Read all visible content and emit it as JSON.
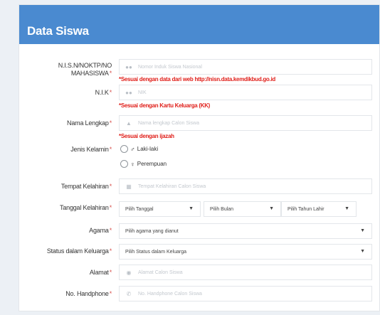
{
  "header": {
    "title": "Data Siswa"
  },
  "fields": {
    "nisn": {
      "label_line1": "N.I.S.N/NOKTP/NO",
      "label_line2": "MAHASISWA",
      "placeholder": "Nomor Induk Siswa Nasional",
      "icon": "user-group-icon"
    },
    "nisn_note": "*Sesuai dengan data dari web http://nisn.data.kemdikbud.go.id",
    "nik": {
      "label": "N.I.K",
      "placeholder": "NIK",
      "icon": "user-group-icon"
    },
    "nik_note": "*Sesuai dengan Kartu Keluarga (KK)",
    "nama": {
      "label": "Nama Lengkap",
      "placeholder": "Nama lengkap Calon Siswa",
      "icon": "user-icon"
    },
    "nama_note": "*Sesuai dengan ijazah",
    "jenis_kelamin": {
      "label": "Jenis Kelamin",
      "options": [
        "Laki-laki",
        "Perempuan"
      ]
    },
    "tempat_lahir": {
      "label": "Tempat Kelahiran",
      "placeholder": "Tempat Kelahiran Calon Siswa",
      "icon": "building-icon"
    },
    "tanggal_lahir": {
      "label": "Tanggal Kelahiran",
      "tanggal": "Pilih Tanggal",
      "bulan": "Pilih Bulan",
      "tahun": "Pilih Tahun Lahir"
    },
    "agama": {
      "label": "Agama",
      "value": "Pilih agama yang dianut"
    },
    "status_keluarga": {
      "label": "Status dalam Keluarga",
      "value": "Pilih Status dalam Keluarga"
    },
    "alamat": {
      "label": "Alamat",
      "placeholder": "Alamat Calon Siswa",
      "icon": "map-marker-icon"
    },
    "handphone": {
      "label": "No. Handphone",
      "placeholder": "No. Handphone Calon Siswa",
      "icon": "phone-icon"
    }
  },
  "required_mark": "*",
  "colors": {
    "header_bg": "#4a8ad0",
    "note_red": "#e0201b"
  }
}
